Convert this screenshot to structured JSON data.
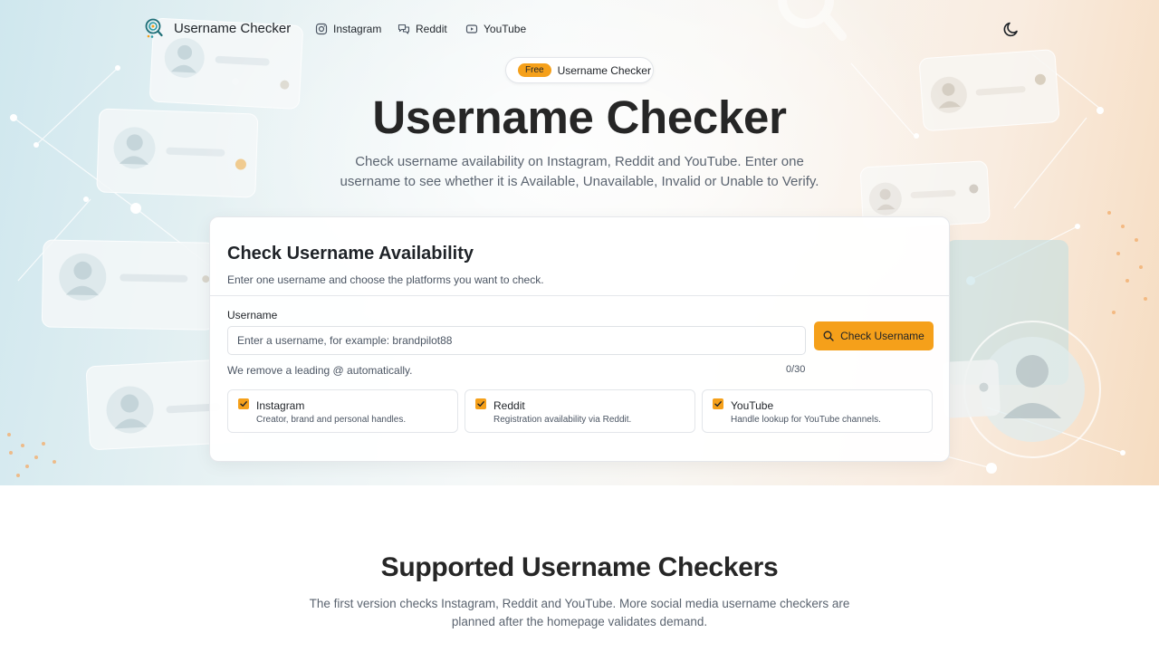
{
  "nav": {
    "brand": "Username Checker",
    "links": [
      {
        "label": "Instagram",
        "icon": "instagram-icon"
      },
      {
        "label": "Reddit",
        "icon": "chat-icon"
      },
      {
        "label": "YouTube",
        "icon": "youtube-icon"
      }
    ],
    "theme_toggle_icon": "moon-icon"
  },
  "hero": {
    "badge": "Free",
    "badge_label": "Username Checker",
    "title": "Username Checker",
    "subtitle": "Check username availability on Instagram, Reddit and YouTube. Enter one username to see whether it is Available, Unavailable, Invalid or Unable to Verify."
  },
  "checker": {
    "title": "Check Username Availability",
    "subtitle": "Enter one username and choose the platforms you want to check.",
    "field_label": "Username",
    "placeholder": "Enter a username, for example: brandpilot88",
    "value": "",
    "button_label": "Check Username",
    "hint": "We remove a leading @ automatically.",
    "counter": "0/30",
    "platforms": [
      {
        "name": "Instagram",
        "description": "Creator, brand and personal handles.",
        "checked": true
      },
      {
        "name": "Reddit",
        "description": "Registration availability via Reddit.",
        "checked": true
      },
      {
        "name": "YouTube",
        "description": "Handle lookup for YouTube channels.",
        "checked": true
      }
    ]
  },
  "supported": {
    "title": "Supported Username Checkers",
    "subtitle": "The first version checks Instagram, Reddit and YouTube. More social media username checkers are planned after the homepage validates demand."
  },
  "colors": {
    "accent": "#f5a01a",
    "text": "#1f2328",
    "muted": "#5b6470"
  }
}
